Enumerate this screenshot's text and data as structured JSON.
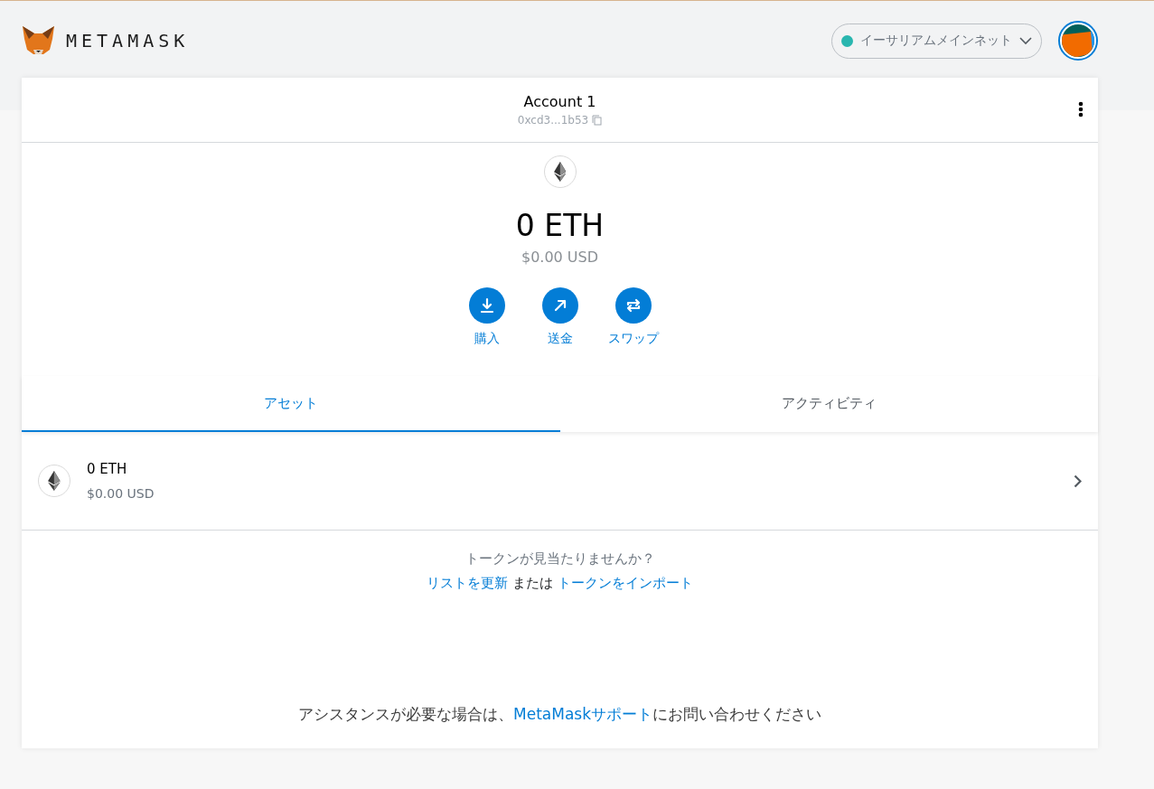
{
  "header": {
    "logo_text": "METAMASK",
    "network": {
      "label": "イーサリアムメインネット"
    }
  },
  "account": {
    "name": "Account 1",
    "address": "0xcd3...1b53"
  },
  "balance": {
    "amount": "0 ETH",
    "fiat": "$0.00 USD"
  },
  "actions": [
    {
      "kind": "buy",
      "label": "購入"
    },
    {
      "kind": "send",
      "label": "送金"
    },
    {
      "kind": "swap",
      "label": "スワップ"
    }
  ],
  "tabs": [
    {
      "label": "アセット",
      "selected": true
    },
    {
      "label": "アクティビティ",
      "selected": false
    }
  ],
  "assets": [
    {
      "amount": "0 ETH",
      "fiat": "$0.00 USD"
    }
  ],
  "token_prompt": {
    "question": "トークンが見当たりませんか？",
    "refresh_link": "リストを更新",
    "connector": "または",
    "import_link": "トークンをインポート"
  },
  "help": {
    "prefix": "アシスタンスが必要な場合は、",
    "link": "MetaMaskサポート",
    "suffix": "にお問い合わせください"
  }
}
